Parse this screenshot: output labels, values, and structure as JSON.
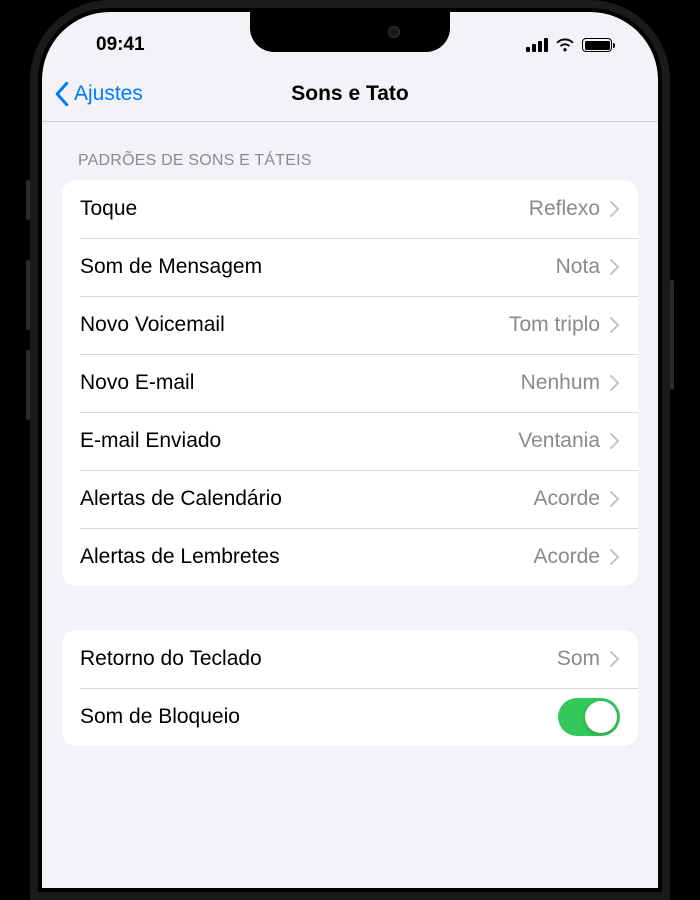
{
  "status": {
    "time": "09:41"
  },
  "nav": {
    "back_label": "Ajustes",
    "title": "Sons e Tato"
  },
  "section1": {
    "header": "PADRÕES DE SONS E TÁTEIS",
    "rows": [
      {
        "label": "Toque",
        "value": "Reflexo"
      },
      {
        "label": "Som de Mensagem",
        "value": "Nota"
      },
      {
        "label": "Novo Voicemail",
        "value": "Tom triplo"
      },
      {
        "label": "Novo E-mail",
        "value": "Nenhum"
      },
      {
        "label": "E-mail Enviado",
        "value": "Ventania"
      },
      {
        "label": "Alertas de Calendário",
        "value": "Acorde"
      },
      {
        "label": "Alertas de Lembretes",
        "value": "Acorde"
      }
    ]
  },
  "section2": {
    "rows": [
      {
        "label": "Retorno do Teclado",
        "value": "Som"
      },
      {
        "label": "Som de Bloqueio",
        "toggle_on": true
      }
    ]
  },
  "colors": {
    "accent": "#007aff",
    "toggle_on": "#34c759",
    "bg": "#f2f2f7",
    "secondary_text": "#8a8a8e"
  }
}
